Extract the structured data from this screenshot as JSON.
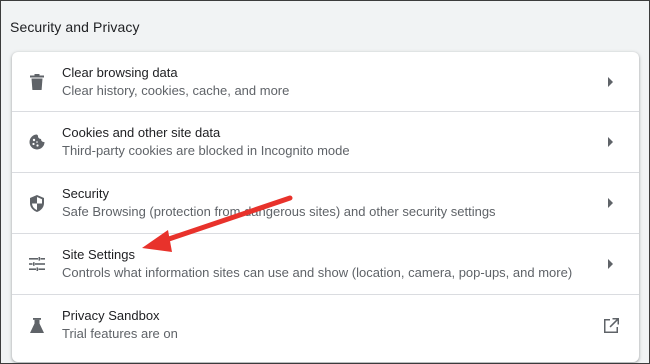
{
  "section": {
    "title": "Security and Privacy"
  },
  "rows": [
    {
      "icon": "trash-icon",
      "label": "Clear browsing data",
      "sub": "Clear history, cookies, cache, and more",
      "trailing": "chevron-right-icon"
    },
    {
      "icon": "cookie-icon",
      "label": "Cookies and other site data",
      "sub": "Third-party cookies are blocked in Incognito mode",
      "trailing": "chevron-right-icon"
    },
    {
      "icon": "shield-icon",
      "label": "Security",
      "sub": "Safe Browsing (protection from dangerous sites) and other security settings",
      "trailing": "chevron-right-icon"
    },
    {
      "icon": "tune-sliders-icon",
      "label": "Site Settings",
      "sub": "Controls what information sites can use and show (location, camera, pop-ups, and more)",
      "trailing": "chevron-right-icon"
    },
    {
      "icon": "flask-icon",
      "label": "Privacy Sandbox",
      "sub": "Trial features are on",
      "trailing": "external-link-icon"
    }
  ],
  "colors": {
    "background": "#f1f3f4",
    "card": "#ffffff",
    "icon": "#5f6368",
    "annotation_arrow": "#e8322b"
  }
}
